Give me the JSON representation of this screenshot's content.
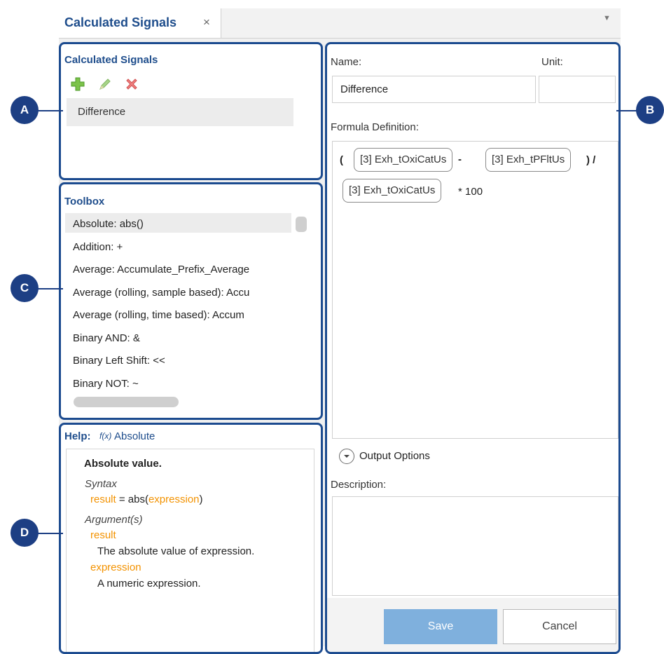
{
  "tab": {
    "title": "Calculated Signals",
    "close": "×",
    "menu": "▼"
  },
  "panelA": {
    "title": "Calculated Signals",
    "signals": [
      "Difference"
    ]
  },
  "toolbox": {
    "title": "Toolbox",
    "items": [
      "Absolute: abs()",
      "Addition:  +",
      "Average: Accumulate_Prefix_Average",
      "Average (rolling, sample based): Accu",
      "Average (rolling, time based): Accum",
      "Binary AND:  &",
      "Binary Left Shift:  <<",
      "Binary NOT: ~"
    ]
  },
  "help": {
    "title": "Help:",
    "fx": "f(x)",
    "function_name": "Absolute",
    "heading": "Absolute value.",
    "syntax_label": "Syntax",
    "syntax_result": "result",
    "syntax_mid": " = abs(",
    "syntax_arg": "expression",
    "syntax_end": ")",
    "args_label": "Argument(s)",
    "arg1_name": "result",
    "arg1_desc": "The absolute value of expression.",
    "arg2_name": "expression",
    "arg2_desc": "A numeric expression."
  },
  "editor": {
    "name_label": "Name:",
    "unit_label": "Unit:",
    "name_value": "Difference",
    "unit_value": "",
    "formula_label": "Formula Definition:",
    "formula": {
      "open_paren": "(",
      "chip1": "[3] Exh_tOxiCatUs",
      "minus": "-",
      "chip2": "[3] Exh_tPFltUs",
      "close_paren_div": ") /",
      "chip3": "[3] Exh_tOxiCatUs",
      "times": "* 100"
    },
    "output_options": "Output Options",
    "description_label": "Description:",
    "description_value": "",
    "save": "Save",
    "cancel": "Cancel"
  },
  "callouts": {
    "a": "A",
    "b": "B",
    "c": "C",
    "d": "D"
  },
  "colors": {
    "accent": "#1c4b8f",
    "callout": "#1d3f84",
    "orange": "#f39200",
    "save": "#7fb0dd"
  }
}
